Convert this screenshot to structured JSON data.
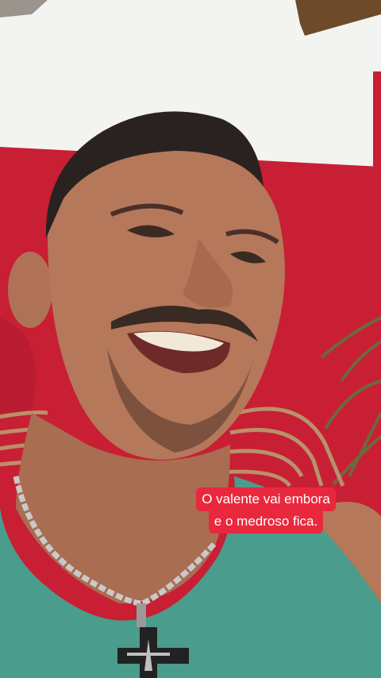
{
  "caption": {
    "lines": [
      "O valente vai embora",
      "e o medroso fica."
    ],
    "background_color": "#e9283d",
    "text_color": "#ffffff"
  },
  "scene": {
    "wall_color": "#c81f35",
    "upper_wall_color": "#f3f3f1",
    "shirt_color": "#4a9c8c",
    "skin_color": "#b5785a",
    "hair_color": "#2a2220"
  }
}
